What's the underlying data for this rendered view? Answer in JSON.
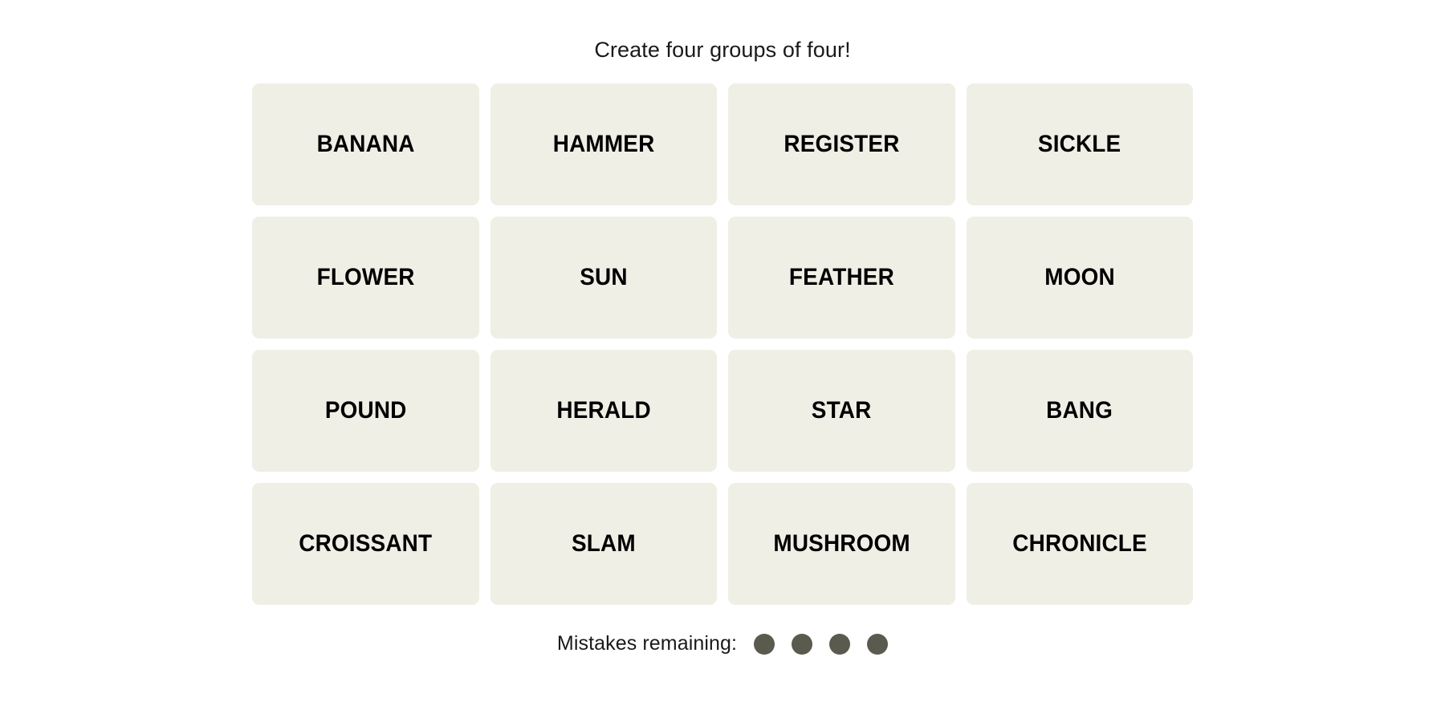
{
  "game": {
    "instruction": "Create four groups of four!",
    "colors": {
      "page_background": "#ffffff",
      "tile_background": "#efefe6",
      "tile_text": "#000000",
      "instruction_text": "#1a1a1a",
      "mistake_dot": "#5a5a4e"
    },
    "grid": {
      "columns": 4,
      "rows": 4,
      "tiles": [
        {
          "label": "BANANA",
          "row": 1,
          "col": 1,
          "selected": false
        },
        {
          "label": "HAMMER",
          "row": 1,
          "col": 2,
          "selected": false
        },
        {
          "label": "REGISTER",
          "row": 1,
          "col": 3,
          "selected": false
        },
        {
          "label": "SICKLE",
          "row": 1,
          "col": 4,
          "selected": false
        },
        {
          "label": "FLOWER",
          "row": 2,
          "col": 1,
          "selected": false
        },
        {
          "label": "SUN",
          "row": 2,
          "col": 2,
          "selected": false
        },
        {
          "label": "FEATHER",
          "row": 2,
          "col": 3,
          "selected": false
        },
        {
          "label": "MOON",
          "row": 2,
          "col": 4,
          "selected": false
        },
        {
          "label": "POUND",
          "row": 3,
          "col": 1,
          "selected": false
        },
        {
          "label": "HERALD",
          "row": 3,
          "col": 2,
          "selected": false
        },
        {
          "label": "STAR",
          "row": 3,
          "col": 3,
          "selected": false
        },
        {
          "label": "BANG",
          "row": 3,
          "col": 4,
          "selected": false
        },
        {
          "label": "CROISSANT",
          "row": 4,
          "col": 1,
          "selected": false
        },
        {
          "label": "SLAM",
          "row": 4,
          "col": 2,
          "selected": false
        },
        {
          "label": "MUSHROOM",
          "row": 4,
          "col": 3,
          "selected": false
        },
        {
          "label": "CHRONICLE",
          "row": 4,
          "col": 4,
          "selected": false
        }
      ]
    },
    "mistakes": {
      "label": "Mistakes remaining:",
      "remaining": 4,
      "dots": [
        "mistake-dot",
        "mistake-dot",
        "mistake-dot",
        "mistake-dot"
      ]
    }
  }
}
